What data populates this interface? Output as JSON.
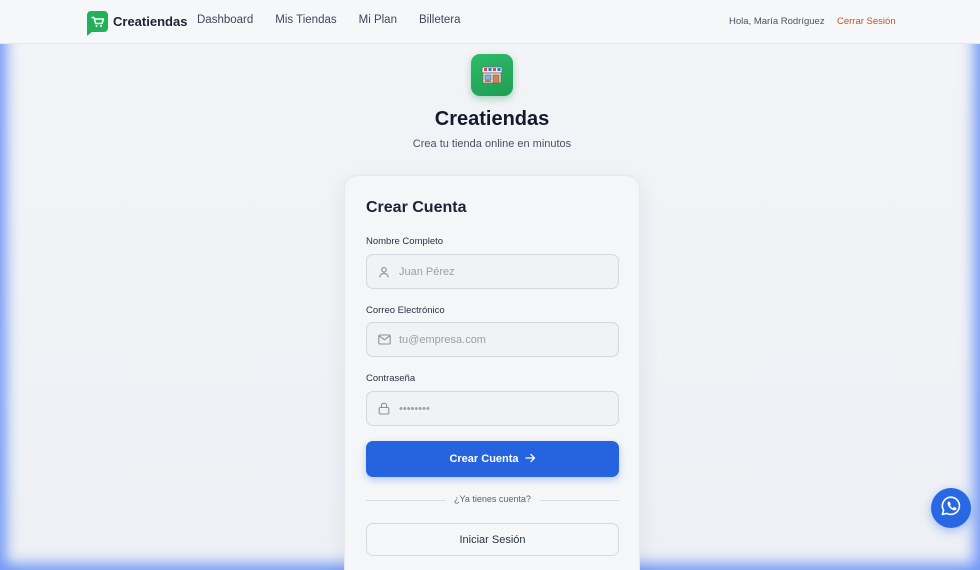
{
  "navbar": {
    "brand": "Creatiendas",
    "links": [
      "Dashboard",
      "Mis Tiendas",
      "Mi Plan",
      "Billetera"
    ],
    "greeting": "Hola, María Rodríguez",
    "logout": "Cerrar Sesión"
  },
  "header": {
    "title": "Creatiendas",
    "subtitle": "Crea tu tienda online en minutos",
    "icon": "store-icon"
  },
  "form": {
    "title": "Crear Cuenta",
    "fields": [
      {
        "label": "Nombre Completo",
        "placeholder": "Juan Pérez",
        "value": "",
        "icon": "user-icon"
      },
      {
        "label": "Correo Electrónico",
        "placeholder": "tu@empresa.com",
        "value": "",
        "icon": "mail-icon"
      },
      {
        "label": "Contraseña",
        "placeholder": "••••••••",
        "value": "",
        "icon": "lock-icon"
      }
    ],
    "submit_label": "Crear Cuenta",
    "divider_text": "¿Ya tienes cuenta?",
    "login_label": "Iniciar Sesión"
  },
  "colors": {
    "brand_green": "#22b05a",
    "primary_blue": "#2563df",
    "logout_orange": "#c2552c"
  },
  "floating": {
    "icon": "whatsapp-icon"
  }
}
